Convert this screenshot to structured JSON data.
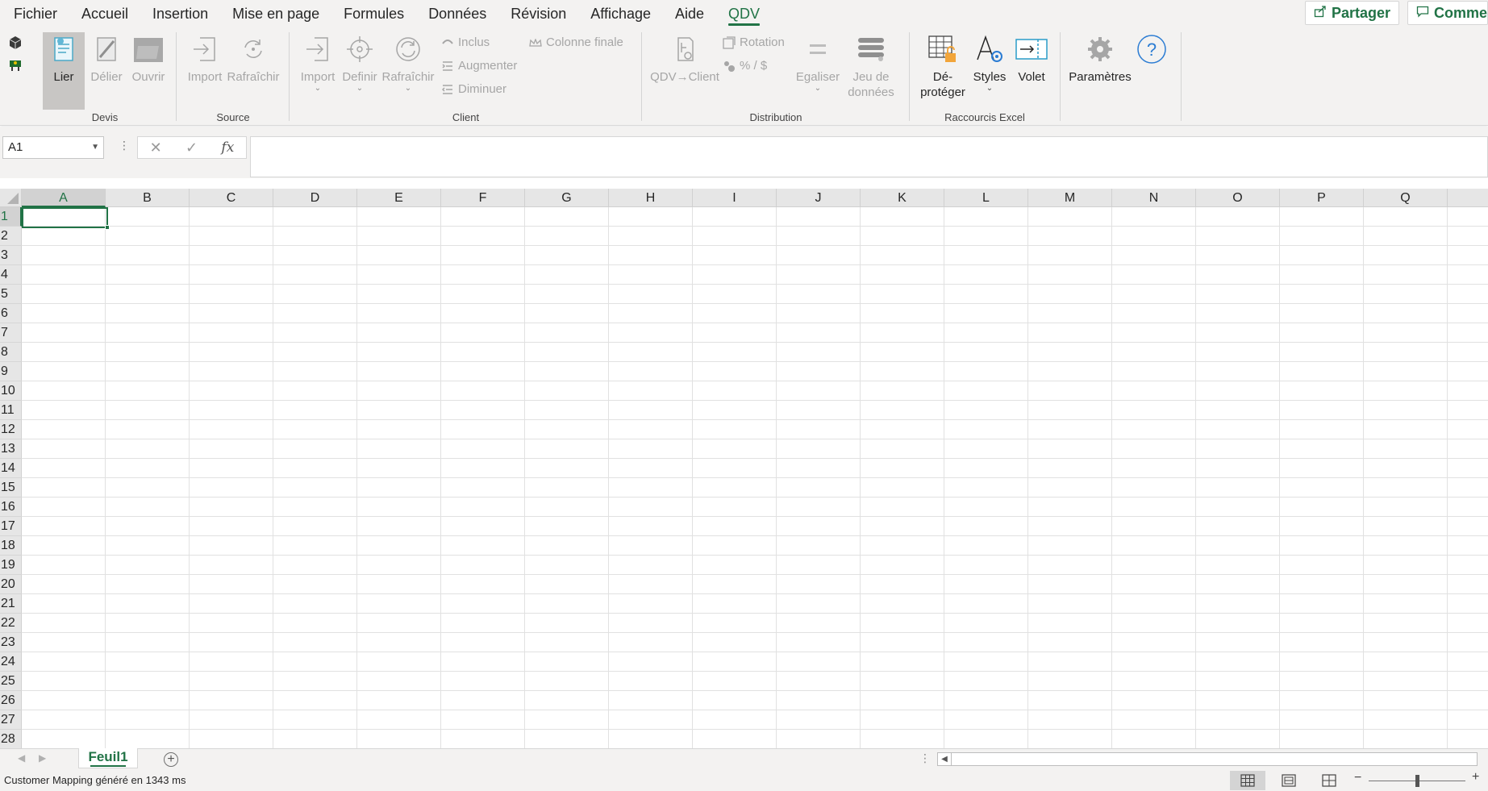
{
  "menu": {
    "tabs": [
      {
        "label": "Fichier"
      },
      {
        "label": "Accueil"
      },
      {
        "label": "Insertion"
      },
      {
        "label": "Mise en page"
      },
      {
        "label": "Formules"
      },
      {
        "label": "Données"
      },
      {
        "label": "Révision"
      },
      {
        "label": "Affichage"
      },
      {
        "label": "Aide"
      },
      {
        "label": "QDV"
      }
    ],
    "active_tab": "QDV",
    "share_label": "Partager",
    "comments_label": "Commen"
  },
  "ribbon": {
    "groups": {
      "devis": {
        "label": "Devis",
        "lier": "Lier",
        "delier": "Délier",
        "ouvrir": "Ouvrir"
      },
      "source": {
        "label": "Source",
        "import": "Import",
        "rafraichir": "Rafraîchir"
      },
      "client": {
        "label": "Client",
        "import": "Import",
        "definir": "Definir",
        "rafraichir": "Rafraîchir",
        "inclus": "Inclus",
        "augmenter": "Augmenter",
        "diminuer": "Diminuer",
        "colonne_finale": "Colonne finale"
      },
      "distribution": {
        "label": "Distribution",
        "qdv_client": "QDV→Client",
        "rotation": "Rotation",
        "percent_dollar": "% / $",
        "egaliser": "Egaliser",
        "jeu_de_donnees_1": "Jeu de",
        "jeu_de_donnees_2": "données"
      },
      "raccourcis": {
        "label": "Raccourcis Excel",
        "deproteger_1": "Dé-",
        "deproteger_2": "protéger",
        "styles": "Styles",
        "volet": "Volet"
      },
      "misc": {
        "parametres": "Paramètres"
      }
    }
  },
  "formula_bar": {
    "name_box": "A1",
    "fx": "fx",
    "formula": ""
  },
  "grid": {
    "columns": [
      "A",
      "B",
      "C",
      "D",
      "E",
      "F",
      "G",
      "H",
      "I",
      "J",
      "K",
      "L",
      "M",
      "N",
      "O",
      "P",
      "Q"
    ],
    "rows": [
      "1",
      "2",
      "3",
      "4",
      "5",
      "6",
      "7",
      "8",
      "9",
      "10",
      "11",
      "12",
      "13",
      "14",
      "15",
      "16",
      "17",
      "18",
      "19",
      "20",
      "21",
      "22",
      "23",
      "24",
      "25",
      "26",
      "27",
      "28"
    ],
    "selected_cell": "A1"
  },
  "sheets": {
    "tabs": [
      "Feuil1"
    ],
    "active": "Feuil1"
  },
  "status": {
    "message": "Customer Mapping généré en 1343 ms"
  },
  "colors": {
    "accent": "#217346",
    "chrome": "#f3f2f1",
    "disabled_text": "#a6a6a6"
  }
}
